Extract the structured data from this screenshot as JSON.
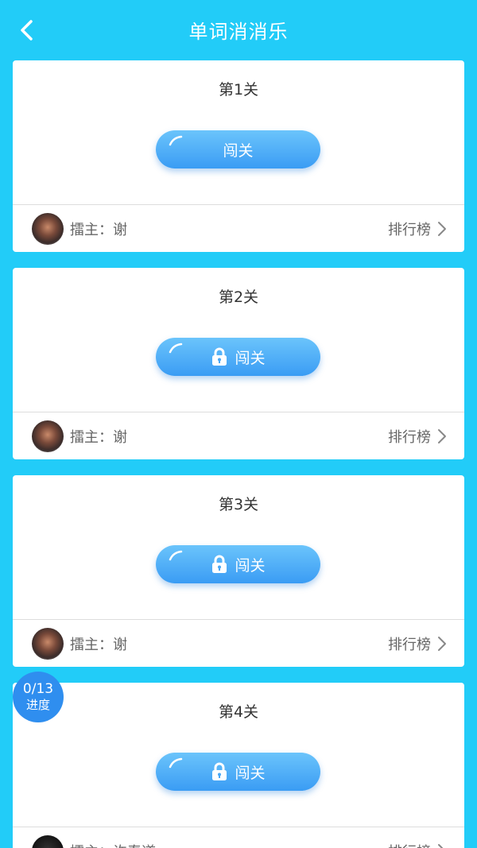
{
  "header": {
    "title": "单词消消乐"
  },
  "levels": [
    {
      "title": "第1关",
      "button_label": "闯关",
      "locked": false,
      "host": "擂主：谢",
      "rank_label": "排行榜"
    },
    {
      "title": "第2关",
      "button_label": "闯关",
      "locked": true,
      "host": "擂主：谢",
      "rank_label": "排行榜"
    },
    {
      "title": "第3关",
      "button_label": "闯关",
      "locked": true,
      "host": "擂主：谢",
      "rank_label": "排行榜"
    },
    {
      "title": "第4关",
      "button_label": "闯关",
      "locked": true,
      "host": "擂主：许春道",
      "rank_label": "排行榜"
    }
  ],
  "progress": {
    "count": "0/13",
    "label": "进度"
  },
  "colors": {
    "background": "#22CCF8",
    "button_gradient_top": "#6BC4FB",
    "button_gradient_bottom": "#3A9CF4",
    "badge": "#2F8EEF"
  },
  "icons": {
    "back": "chevron-left-icon",
    "lock": "lock-icon",
    "rank_arrow": "chevron-right-icon"
  }
}
